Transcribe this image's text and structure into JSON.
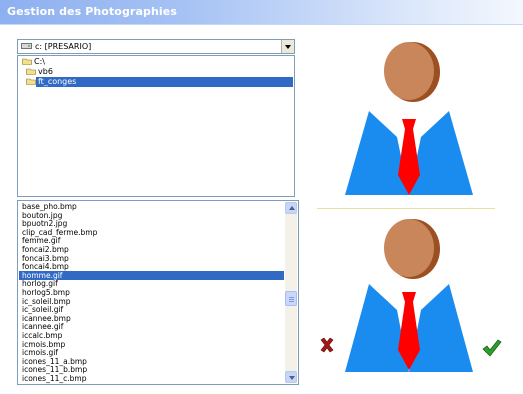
{
  "window": {
    "title": "Gestion des Photographies"
  },
  "drive": {
    "label": "c: [PRESARIO]"
  },
  "directories": [
    {
      "label": "C:\\",
      "selected": false
    },
    {
      "label": "vb6",
      "selected": false
    },
    {
      "label": "ft_conges",
      "selected": true
    }
  ],
  "files": [
    {
      "label": "base_pho.bmp",
      "selected": false
    },
    {
      "label": "bouton.jpg",
      "selected": false
    },
    {
      "label": "bpuotn2.jpg",
      "selected": false
    },
    {
      "label": "clip_cad_ferme.bmp",
      "selected": false
    },
    {
      "label": "femme.gif",
      "selected": false
    },
    {
      "label": "foncai2.bmp",
      "selected": false
    },
    {
      "label": "foncai3.bmp",
      "selected": false
    },
    {
      "label": "foncai4.bmp",
      "selected": false
    },
    {
      "label": "homme.gif",
      "selected": true
    },
    {
      "label": "horlog.gif",
      "selected": false
    },
    {
      "label": "horlog5.bmp",
      "selected": false
    },
    {
      "label": "ic_soleil.bmp",
      "selected": false
    },
    {
      "label": "ic_soleil.gif",
      "selected": false
    },
    {
      "label": "icannee.bmp",
      "selected": false
    },
    {
      "label": "icannee.gif",
      "selected": false
    },
    {
      "label": "iccalc.bmp",
      "selected": false
    },
    {
      "label": "icmois.bmp",
      "selected": false
    },
    {
      "label": "icmois.gif",
      "selected": false
    },
    {
      "label": "icones_11_a.bmp",
      "selected": false
    },
    {
      "label": "icones_11_b.bmp",
      "selected": false
    },
    {
      "label": "icones_11_c.bmp",
      "selected": false
    }
  ],
  "preview": {
    "image": "homme.gif",
    "icon": "man-with-red-tie-icon"
  },
  "actions": {
    "cancel_icon": "red-x-icon",
    "confirm_icon": "green-checkmark-icon"
  },
  "colors": {
    "title_bar": "#a6c2f4",
    "selection": "#316ac5",
    "suit": "#1a8cf0",
    "tie": "#ff0000",
    "head": "#c8865a"
  }
}
